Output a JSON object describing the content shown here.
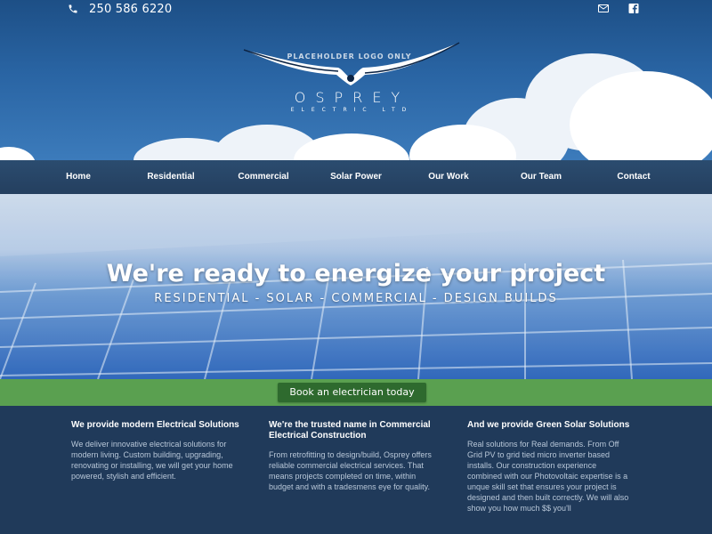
{
  "header": {
    "phone": "250 586 6220",
    "phone_icon": "phone-icon",
    "social": [
      {
        "name": "mail-icon"
      },
      {
        "name": "facebook-icon"
      }
    ],
    "logo": {
      "placeholder": "PLACEHOLDER LOGO ONLY",
      "brand": "OSPREY",
      "sub": "ELECTRIC LTD"
    }
  },
  "nav": {
    "items": [
      {
        "label": "Home"
      },
      {
        "label": "Residential"
      },
      {
        "label": "Commercial"
      },
      {
        "label": "Solar Power"
      },
      {
        "label": "Our Work"
      },
      {
        "label": "Our Team"
      },
      {
        "label": "Contact"
      }
    ]
  },
  "hero": {
    "title": "We're ready to energize your project",
    "tagline": "RESIDENTIAL - SOLAR - COMMERCIAL - DESIGN BUILDS"
  },
  "cta": {
    "label": "Book an electrician today"
  },
  "columns": [
    {
      "title": "We provide modern Electrical Solutions",
      "body": "We deliver innovative electrical solutions for modern living. Custom building, upgrading, renovating or installing, we will get your home powered, stylish and efficient."
    },
    {
      "title": "We're the trusted name in Commercial Electrical Construction",
      "body": "From retrofitting to design/build, Osprey offers reliable commercial electrical services. That means projects completed on time, within budget and with a tradesmens eye for quality."
    },
    {
      "title": "And we provide Green Solar Solutions",
      "body": "Real solutions for Real demands. From Off Grid PV to grid tied micro inverter based installs. Our construction experience combined with our Photovoltaic expertise is a unque skill set that ensures your project is designed and then built correctly. We will also show you how much $$ you'll"
    }
  ],
  "colors": {
    "nav_bg": "#243f5f",
    "cta_band": "#5aa050",
    "cta_button": "#2e6a2e",
    "content_bg": "#203a5a"
  }
}
